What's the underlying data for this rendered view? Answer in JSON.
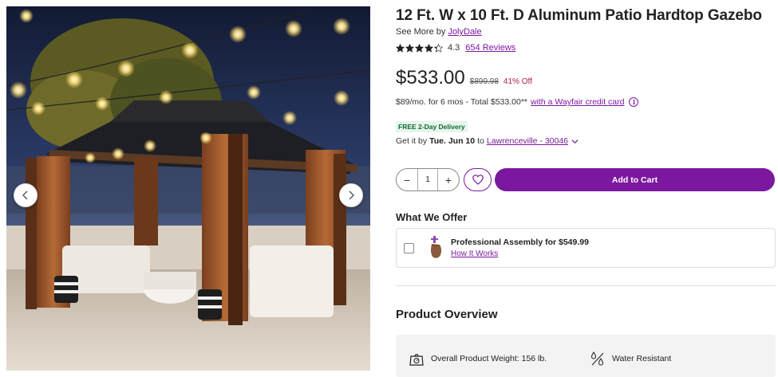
{
  "product": {
    "title": "12 Ft. W x 10 Ft. D Aluminum Patio Hardtop Gazebo",
    "see_more_prefix": "See More by",
    "brand": "JolyDale",
    "rating": "4.3",
    "rating_value": 4.3,
    "reviews": "654 Reviews"
  },
  "pricing": {
    "price": "$533.00",
    "was_price": "$899.98",
    "discount": "41% Off",
    "finance_text": "$89/mo. for 6 mos - Total $533.00**",
    "finance_link": "with a Wayfair credit card",
    "info_glyph": "i"
  },
  "delivery": {
    "badge": "FREE 2-Day Delivery",
    "prefix": "Get it by",
    "date": "Tue. Jun 10",
    "to": "to",
    "location": "Lawrenceville - 30046"
  },
  "purchase": {
    "qty_minus": "−",
    "quantity": "1",
    "qty_plus": "+",
    "add_to_cart": "Add to Cart"
  },
  "offer": {
    "heading": "What We Offer",
    "assembly_label": "Professional Assembly for $549.99",
    "how_it_works": "How It Works"
  },
  "overview": {
    "heading": "Product Overview",
    "weight": "Overall Product Weight: 156 lb.",
    "water": "Water Resistant"
  },
  "icons": {
    "prev": "chevron-left-icon",
    "next": "chevron-right-icon",
    "favorite": "heart-icon",
    "weight": "scale-icon",
    "water": "water-drops-icon",
    "assembly": "assembly-hand-icon"
  },
  "colors": {
    "brand_purple": "#7b189f",
    "discount_red": "#b4194e",
    "delivery_green": "#0d6b2f"
  }
}
